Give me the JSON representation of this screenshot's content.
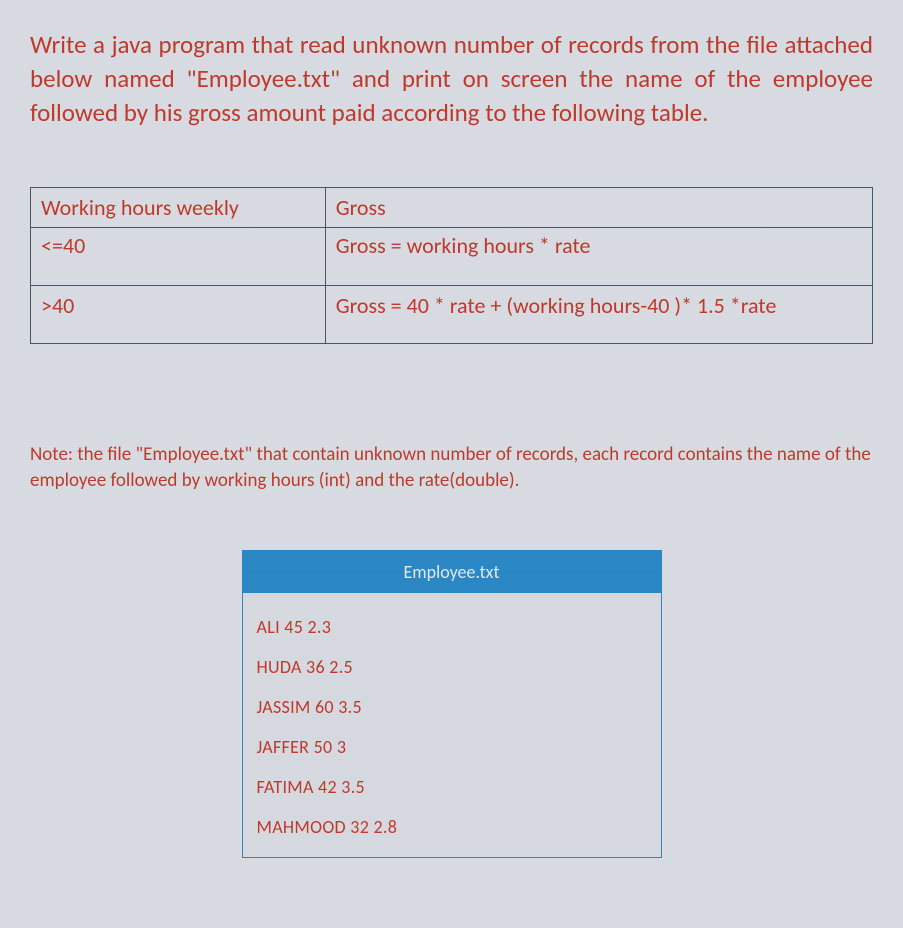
{
  "prompt": "Write a java program that read unknown number of records from the file attached below named \"Employee.txt\" and print on screen the name of the employee followed by his gross amount paid according to the following table.",
  "table": {
    "headers": {
      "hours": "Working hours weekly",
      "gross": "Gross"
    },
    "rows": [
      {
        "hours": "<=40",
        "gross": "Gross = working hours * rate"
      },
      {
        "hours": ">40",
        "gross": "Gross = 40 * rate + (working hours-40 )* 1.5 *rate"
      }
    ]
  },
  "note": "Note: the file \"Employee.txt\" that contain unknown number of records, each record contains the name of the employee followed by working hours (int) and the rate(double).",
  "file": {
    "title": "Employee.txt",
    "records": [
      "ALI 45 2.3",
      "HUDA 36 2.5",
      "JASSIM 60 3.5",
      "JAFFER 50 3",
      "FATIMA 42 3.5",
      "MAHMOOD 32 2.8"
    ]
  }
}
